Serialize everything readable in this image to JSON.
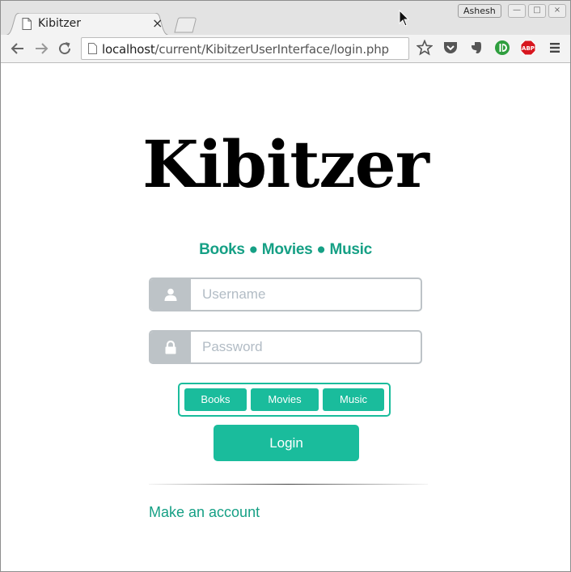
{
  "browser": {
    "tab": {
      "title": "Kibitzer",
      "close_glyph": "×"
    },
    "profile_name": "Ashesh",
    "window_buttons": {
      "minimize": "—",
      "restore": "□",
      "close": "×"
    },
    "url": {
      "host": "localhost",
      "path": "/current/KibitzerUserInterface/login.php"
    },
    "extensions": [
      "pocket-icon",
      "evernote-icon",
      "ublock-icon",
      "adblock-plus-icon"
    ],
    "adblock_label": "ABP"
  },
  "page": {
    "brand": "Kibitzer",
    "tagline": "Books ● Movies ● Music",
    "username": {
      "placeholder": "Username",
      "value": ""
    },
    "password": {
      "placeholder": "Password",
      "value": ""
    },
    "categories": [
      "Books",
      "Movies",
      "Music"
    ],
    "login_label": "Login",
    "make_account_label": "Make an account"
  },
  "colors": {
    "accent": "#1abc9c",
    "accent_dark": "#16a085",
    "input_border": "#bdc3c7",
    "placeholder": "#b2bcc5"
  }
}
